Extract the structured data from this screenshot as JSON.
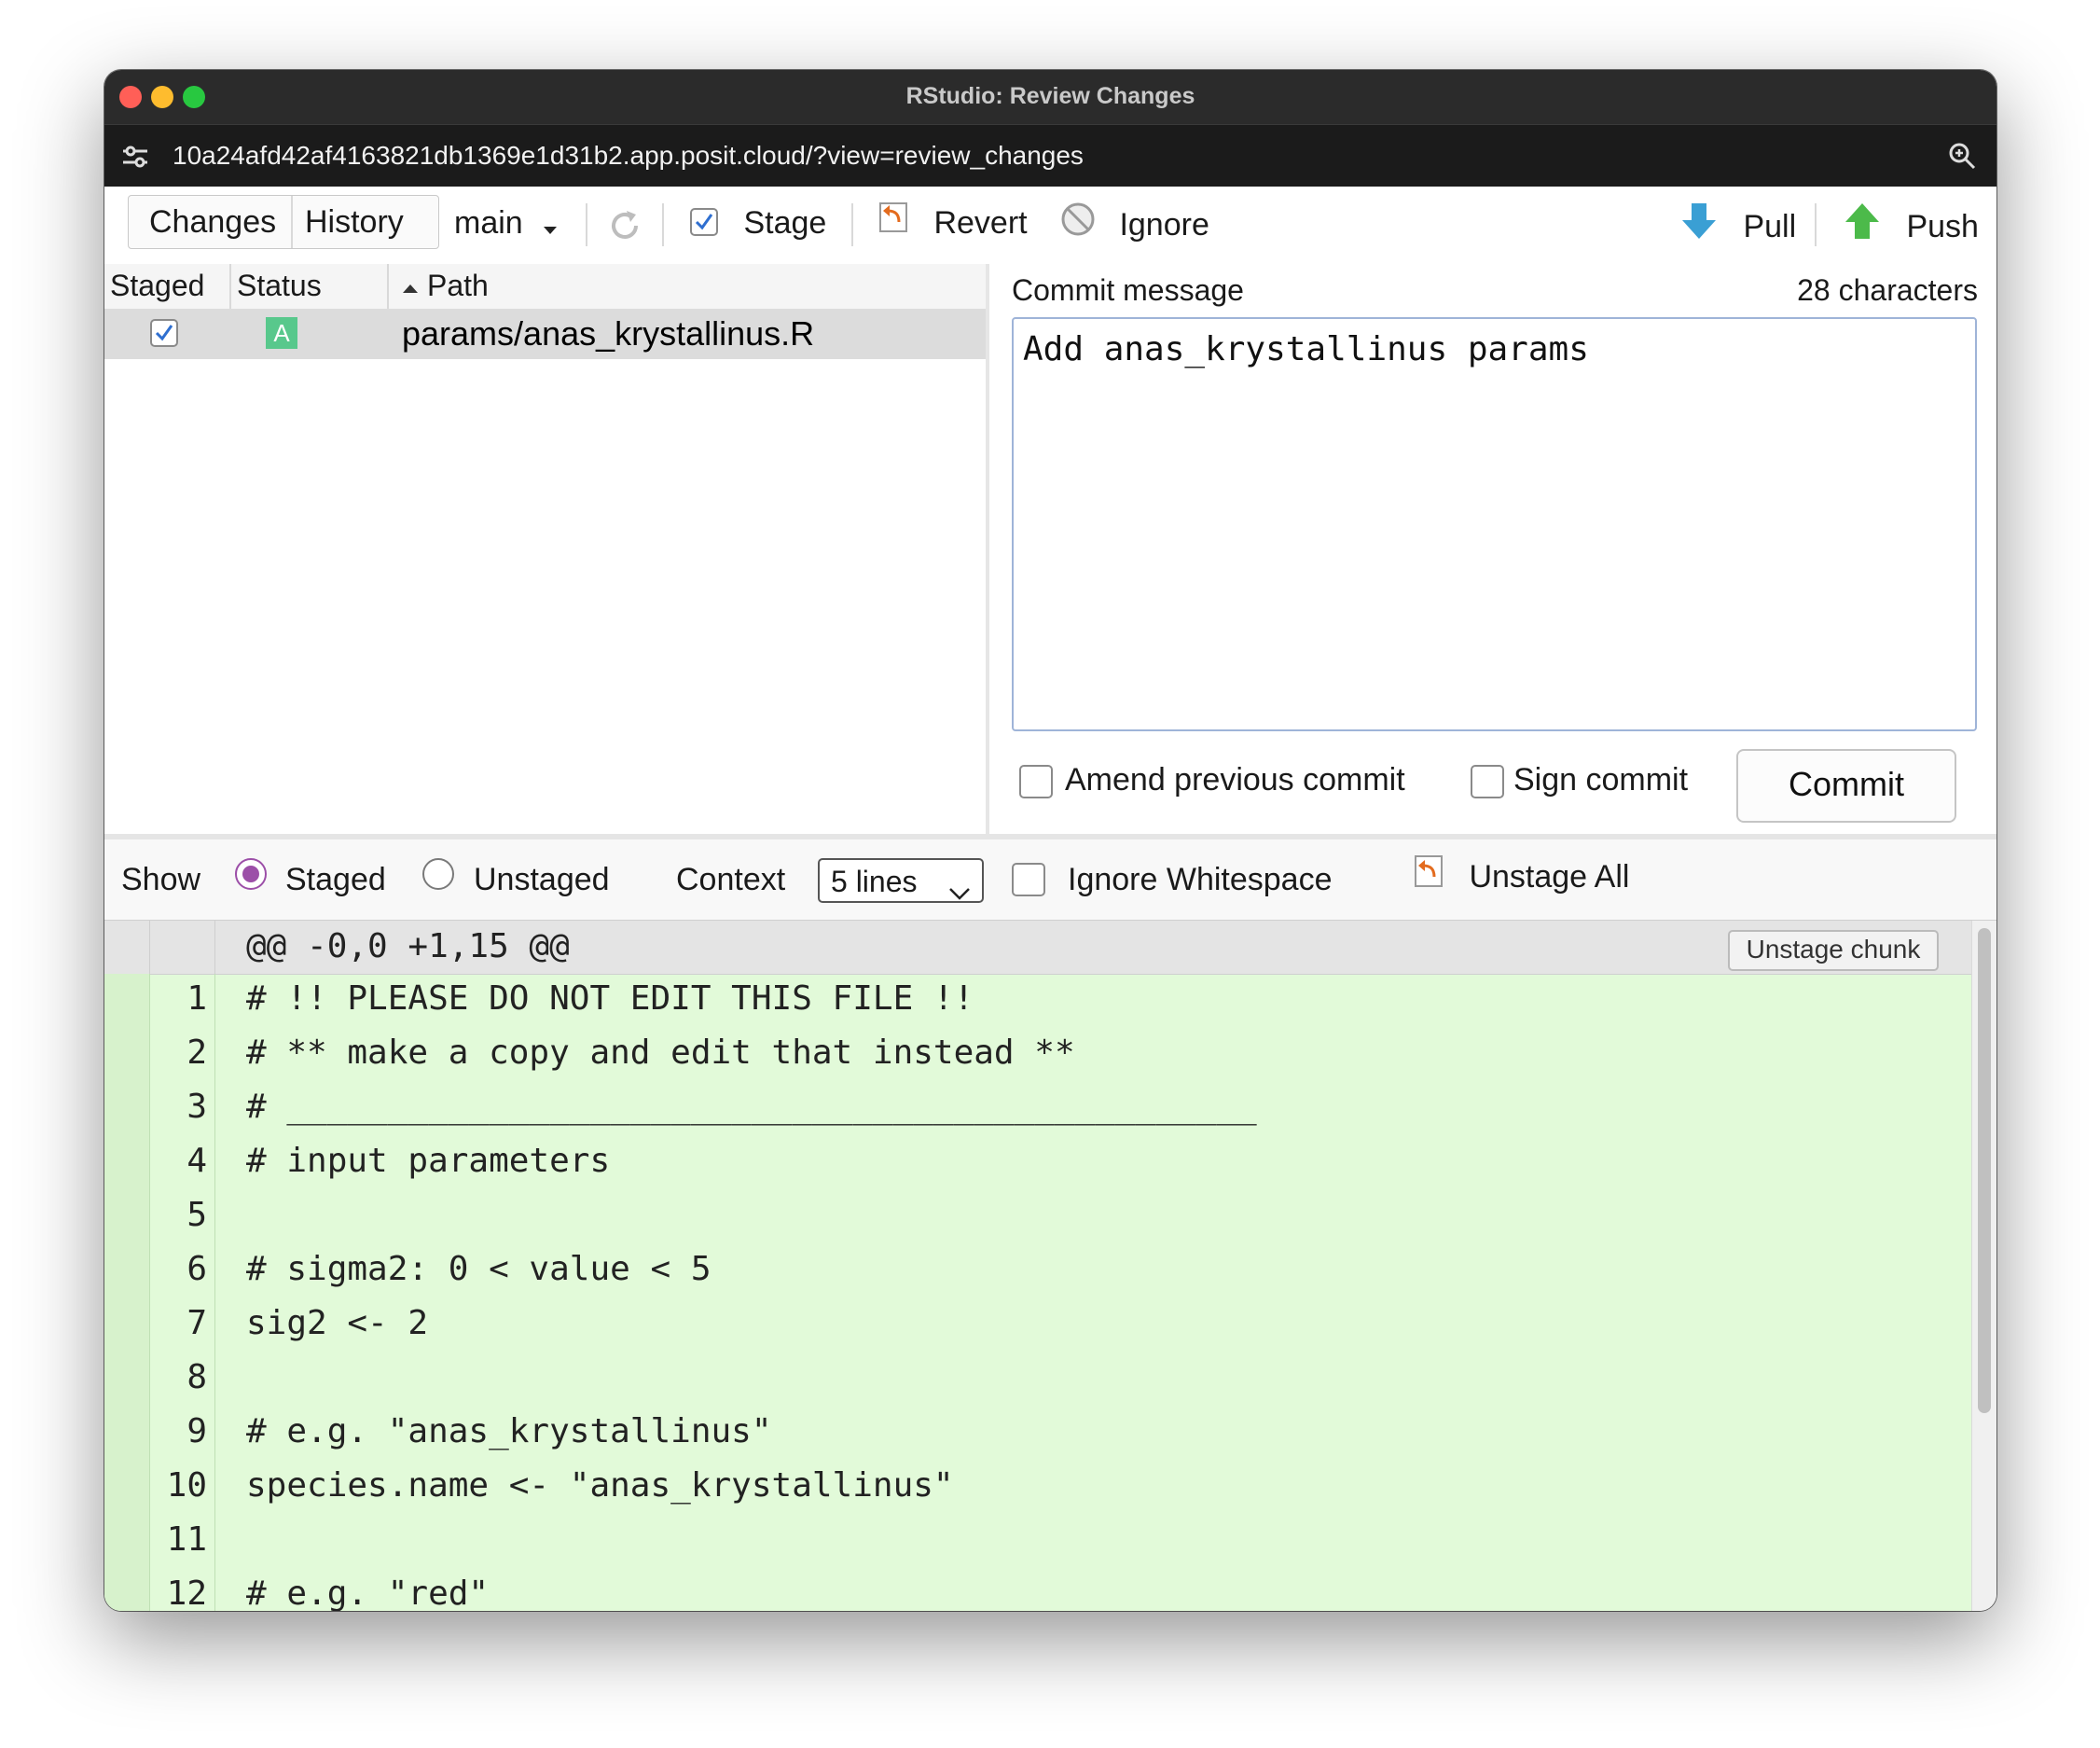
{
  "window": {
    "title": "RStudio: Review Changes"
  },
  "urlbar": {
    "url": "10a24afd42af4163821db1369e1d31b2.app.posit.cloud/?view=review_changes"
  },
  "toolbar": {
    "tab_changes": "Changes",
    "tab_history": "History",
    "branch": "main",
    "stage": "Stage",
    "revert": "Revert",
    "ignore": "Ignore",
    "pull": "Pull",
    "push": "Push"
  },
  "files_table": {
    "headers": {
      "staged": "Staged",
      "status": "Status",
      "path": "Path"
    },
    "rows": [
      {
        "staged": true,
        "status": "A",
        "path": "params/anas_krystallinus.R"
      }
    ]
  },
  "commit": {
    "label": "Commit message",
    "count": "28 characters",
    "message": "Add anas_krystallinus params",
    "amend": "Amend previous commit",
    "sign": "Sign commit",
    "button": "Commit"
  },
  "showbar": {
    "show": "Show",
    "staged": "Staged",
    "unstaged": "Unstaged",
    "context": "Context",
    "context_value": "5 lines",
    "ignore_ws": "Ignore Whitespace",
    "unstage_all": "Unstage All",
    "selected": "staged"
  },
  "diff": {
    "hunk": "@@ -0,0 +1,15 @@",
    "unstage_chunk": "Unstage chunk",
    "lines": [
      {
        "n": "1",
        "code": "# !! PLEASE DO NOT EDIT THIS FILE !!"
      },
      {
        "n": "2",
        "code": "# ** make a copy and edit that instead **"
      },
      {
        "n": "3",
        "code": "# ________________________________________________"
      },
      {
        "n": "4",
        "code": "# input parameters"
      },
      {
        "n": "5",
        "code": ""
      },
      {
        "n": "6",
        "code": "# sigma2: 0 < value < 5"
      },
      {
        "n": "7",
        "code": "sig2 <- 2"
      },
      {
        "n": "8",
        "code": ""
      },
      {
        "n": "9",
        "code": "# e.g. \"anas_krystallinus\""
      },
      {
        "n": "10",
        "code": "species.name <- \"anas_krystallinus\""
      },
      {
        "n": "11",
        "code": ""
      },
      {
        "n": "12",
        "code": "# e.g. \"red\""
      }
    ]
  },
  "colors": {
    "added_bg": "#e2fad9",
    "accent": "#9c4fa8",
    "titlebar": "#2b2b2b"
  }
}
